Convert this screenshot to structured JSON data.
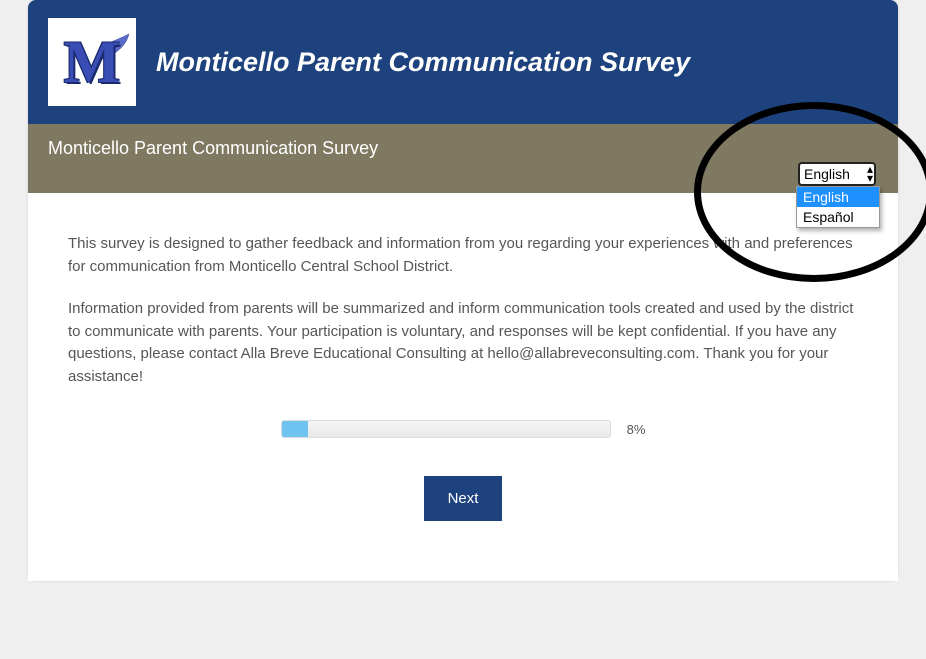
{
  "header": {
    "title": "Monticello Parent Communication Survey",
    "logo_letter": "M"
  },
  "subheader": {
    "title": "Monticello Parent Communication Survey"
  },
  "language": {
    "selected": "English",
    "options": [
      "English",
      "Español"
    ]
  },
  "intro": {
    "p1": "This survey is designed to gather feedback and information from you regarding your experiences with and preferences for communication from Monticello Central School District.",
    "p2": "Information provided from parents will be summarized and inform communication tools created and used by the district to communicate with parents. Your participation is voluntary, and responses will be kept confidential. If you have any questions, please contact Alla Breve Educational Consulting at hello@allabreveconsulting.com. Thank you for your assistance!"
  },
  "progress": {
    "percent": 8,
    "label": "8%"
  },
  "buttons": {
    "next": "Next"
  }
}
